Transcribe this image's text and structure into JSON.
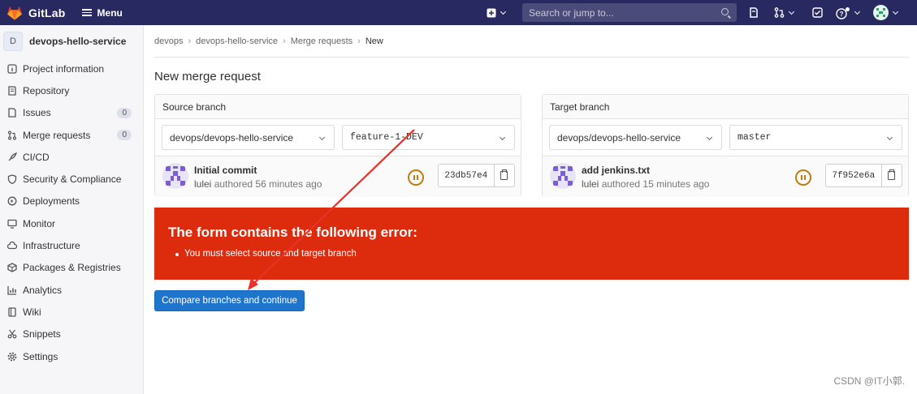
{
  "app": {
    "name": "GitLab",
    "menu_label": "Menu"
  },
  "search": {
    "placeholder": "Search or jump to..."
  },
  "project": {
    "initial": "D",
    "name": "devops-hello-service"
  },
  "sidebar": {
    "items": [
      {
        "label": "Project information",
        "icon": "info-icon"
      },
      {
        "label": "Repository",
        "icon": "repository-icon"
      },
      {
        "label": "Issues",
        "icon": "issues-icon",
        "badge": "0"
      },
      {
        "label": "Merge requests",
        "icon": "merge-request-icon",
        "badge": "0"
      },
      {
        "label": "CI/CD",
        "icon": "rocket-icon"
      },
      {
        "label": "Security & Compliance",
        "icon": "shield-icon"
      },
      {
        "label": "Deployments",
        "icon": "deployments-icon"
      },
      {
        "label": "Monitor",
        "icon": "monitor-icon"
      },
      {
        "label": "Infrastructure",
        "icon": "cloud-icon"
      },
      {
        "label": "Packages & Registries",
        "icon": "package-icon"
      },
      {
        "label": "Analytics",
        "icon": "chart-icon"
      },
      {
        "label": "Wiki",
        "icon": "book-icon"
      },
      {
        "label": "Snippets",
        "icon": "scissors-icon"
      },
      {
        "label": "Settings",
        "icon": "gear-icon"
      }
    ]
  },
  "breadcrumb": [
    "devops",
    "devops-hello-service",
    "Merge requests",
    "New"
  ],
  "page_title": "New merge request",
  "source": {
    "header": "Source branch",
    "project": "devops/devops-hello-service",
    "branch": "feature-1-DEV",
    "commit_title": "Initial commit",
    "author": "lulei",
    "authored": "authored 56 minutes ago",
    "sha": "23db57e4"
  },
  "target": {
    "header": "Target branch",
    "project": "devops/devops-hello-service",
    "branch": "master",
    "commit_title": "add jenkins.txt",
    "author": "lulei",
    "authored": "authored 15 minutes ago",
    "sha": "7f952e6a"
  },
  "error": {
    "heading": "The form contains the following error:",
    "item": "You must select source and target branch"
  },
  "compare_button": "Compare branches and continue",
  "watermark": "CSDN @IT小郭.",
  "colors": {
    "topbar": "#292961",
    "error": "#dd2b0e",
    "primary": "#1f75cb",
    "annotation_arrow": "#e8322a"
  }
}
